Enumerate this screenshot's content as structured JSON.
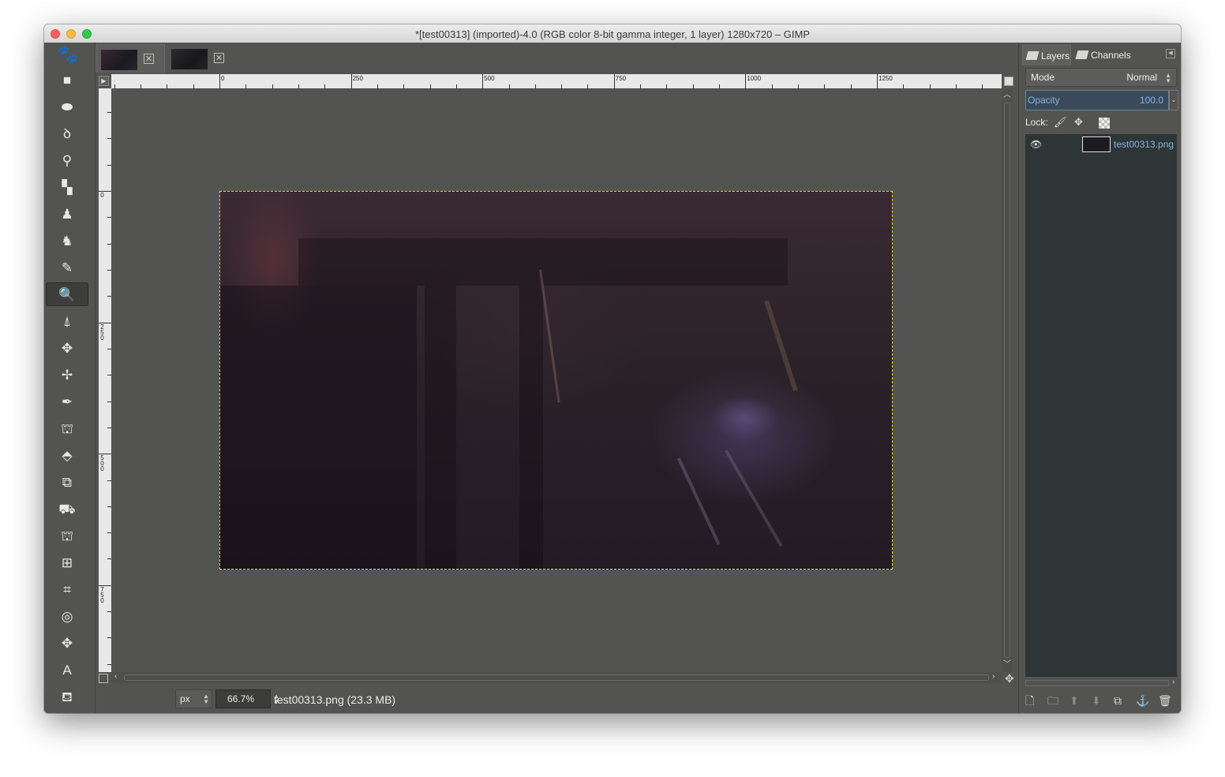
{
  "window": {
    "title": "*[test00313] (imported)-4.0 (RGB color 8-bit gamma integer, 1 layer) 1280x720 – GIMP"
  },
  "toolbox": {
    "tools": [
      {
        "name": "rect-select-tool",
        "glyph": "■"
      },
      {
        "name": "ellipse-select-tool",
        "glyph": "⬬"
      },
      {
        "name": "free-select-tool",
        "glyph": "ꝺ"
      },
      {
        "name": "fuzzy-select-tool",
        "glyph": "⚲"
      },
      {
        "name": "select-by-color-tool",
        "glyph": "▚"
      },
      {
        "name": "foreground-select-tool",
        "glyph": "♟"
      },
      {
        "name": "paths-tool",
        "glyph": "♞"
      },
      {
        "name": "color-picker-tool",
        "glyph": "✎"
      },
      {
        "name": "zoom-tool",
        "glyph": "🔍"
      },
      {
        "name": "measure-tool",
        "glyph": "⍋"
      },
      {
        "name": "move-tool",
        "glyph": "✥"
      },
      {
        "name": "align-tool",
        "glyph": "✢"
      },
      {
        "name": "crop-tool",
        "glyph": "✒"
      },
      {
        "name": "rotate-tool",
        "glyph": "⛫"
      },
      {
        "name": "scale-tool",
        "glyph": "⬘"
      },
      {
        "name": "shear-tool",
        "glyph": "⧉"
      },
      {
        "name": "perspective-tool",
        "glyph": "⛟"
      },
      {
        "name": "flip-tool",
        "glyph": "⛫"
      },
      {
        "name": "cage-transform-tool",
        "glyph": "⊞"
      },
      {
        "name": "warp-transform-tool",
        "glyph": "⌗"
      },
      {
        "name": "spiral-tool",
        "glyph": "◎"
      },
      {
        "name": "move-tool-2",
        "glyph": "✥"
      },
      {
        "name": "text-tool",
        "glyph": "A"
      },
      {
        "name": "bucket-fill-tool",
        "glyph": "⛾"
      }
    ],
    "active_index": 8
  },
  "ruler": {
    "h_labels": [
      "0",
      "250",
      "500",
      "750",
      "1000",
      "1250"
    ],
    "v_labels": [
      "0",
      "250",
      "500",
      "750"
    ]
  },
  "status": {
    "unit": "px",
    "zoom": "66.7%",
    "file_info": "test00313.png (23.3 MB)"
  },
  "dock": {
    "tabs": [
      "Layers",
      "Channels"
    ],
    "mode_label": "Mode",
    "mode_value": "Normal",
    "opacity_label": "Opacity",
    "opacity_value": "100.0",
    "lock_label": "Lock:",
    "layer_name": "test00313.png"
  }
}
